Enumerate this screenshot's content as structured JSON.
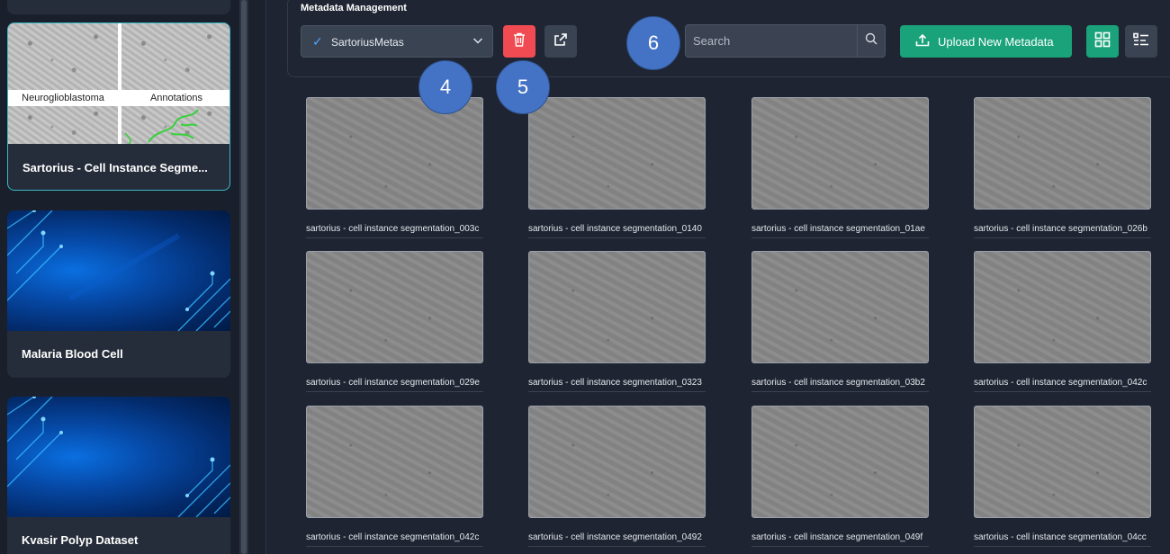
{
  "sidebar": {
    "datasets": [
      {
        "title": "Sartorius - Cell Instance Segme...",
        "thumb_labels": [
          "Neuroglioblastoma",
          "Annotations"
        ],
        "selected": true
      },
      {
        "title": "Malaria Blood Cell",
        "selected": false
      },
      {
        "title": "Kvasir Polyp Dataset",
        "selected": false
      }
    ]
  },
  "toolbar": {
    "section_title": "Metadata Management",
    "selected_metadata": "SartoriusMetas",
    "search_placeholder": "Search",
    "upload_label": "Upload New Metadata"
  },
  "callouts": [
    "4",
    "5",
    "6"
  ],
  "grid": {
    "items": [
      "sartorius - cell instance segmentation_003c",
      "sartorius - cell instance segmentation_0140",
      "sartorius - cell instance segmentation_01ae",
      "sartorius - cell instance segmentation_026b",
      "sartorius - cell instance segmentation_029e",
      "sartorius - cell instance segmentation_0323",
      "sartorius - cell instance segmentation_03b2",
      "sartorius - cell instance segmentation_042c",
      "sartorius - cell instance segmentation_042c",
      "sartorius - cell instance segmentation_0492",
      "sartorius - cell instance segmentation_049f",
      "sartorius - cell instance segmentation_04cc"
    ]
  },
  "colors": {
    "accent_green": "#1aa27a",
    "danger_red": "#f04a52",
    "callout_blue": "#4472c4",
    "selected_border": "#39b7c6"
  },
  "icons": {
    "check": "check-icon",
    "chevron": "chevron-down-icon",
    "delete": "trash-icon",
    "external": "external-link-icon",
    "search": "search-icon",
    "upload": "upload-icon",
    "grid_view": "grid-view-icon",
    "list_view": "list-view-icon"
  }
}
